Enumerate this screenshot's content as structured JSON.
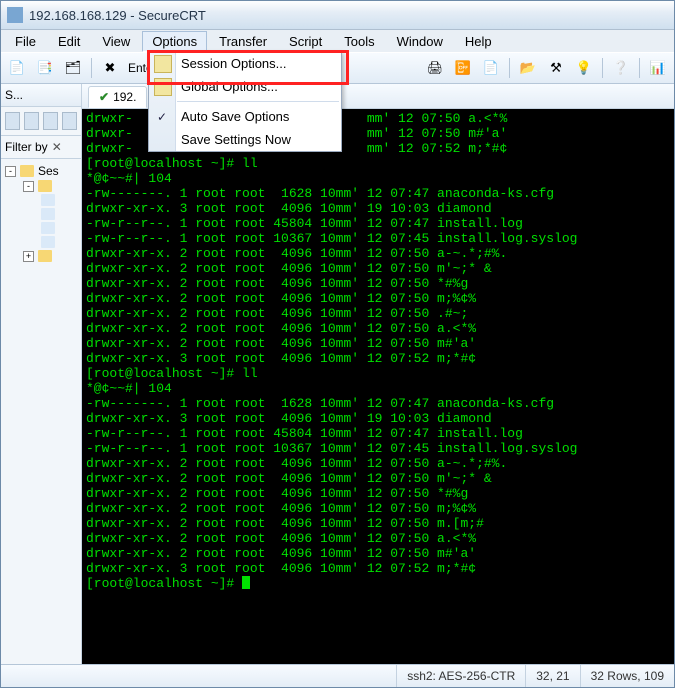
{
  "window": {
    "title": "192.168.168.129 - SecureCRT"
  },
  "menubar": [
    "File",
    "Edit",
    "View",
    "Options",
    "Transfer",
    "Script",
    "Tools",
    "Window",
    "Help"
  ],
  "menubar_open_index": 3,
  "toolbar": {
    "entry_label": "Ente"
  },
  "options_menu": {
    "session_options": "Session Options...",
    "global_options": "Global Options...",
    "auto_save": "Auto Save Options",
    "save_now": "Save Settings Now",
    "auto_save_checked": true
  },
  "sidebar": {
    "tab_label": "S...",
    "filter_label": "Filter by",
    "tree_root": "Ses"
  },
  "tab": {
    "label": "192."
  },
  "terminal_lines": [
    "drwxr-                              mm' 12 07:50 a.<*%",
    "drwxr-                              mm' 12 07:50 m#'a'",
    "drwxr-                              mm' 12 07:52 m;*#¢",
    "[root@localhost ~]# ll",
    "*@¢~~#| 104",
    "-rw-------. 1 root root  1628 10mm' 12 07:47 anaconda-ks.cfg",
    "drwxr-xr-x. 3 root root  4096 10mm' 19 10:03 diamond",
    "-rw-r--r--. 1 root root 45804 10mm' 12 07:47 install.log",
    "-rw-r--r--. 1 root root 10367 10mm' 12 07:45 install.log.syslog",
    "drwxr-xr-x. 2 root root  4096 10mm' 12 07:50 a-~.*;#%.",
    "drwxr-xr-x. 2 root root  4096 10mm' 12 07:50 m'~;* &",
    "drwxr-xr-x. 2 root root  4096 10mm' 12 07:50 *#%g  ",
    "drwxr-xr-x. 2 root root  4096 10mm' 12 07:50 m;%¢%",
    "drwxr-xr-x. 2 root root  4096 10mm' 12 07:50 .#~;  ",
    "drwxr-xr-x. 2 root root  4096 10mm' 12 07:50 a.<*% ",
    "drwxr-xr-x. 2 root root  4096 10mm' 12 07:50 m#'a' ",
    "drwxr-xr-x. 3 root root  4096 10mm' 12 07:52 m;*#¢ ",
    "[root@localhost ~]# ll",
    "*@¢~~#| 104",
    "-rw-------. 1 root root  1628 10mm' 12 07:47 anaconda-ks.cfg",
    "drwxr-xr-x. 3 root root  4096 10mm' 19 10:03 diamond",
    "-rw-r--r--. 1 root root 45804 10mm' 12 07:47 install.log",
    "-rw-r--r--. 1 root root 10367 10mm' 12 07:45 install.log.syslog",
    "drwxr-xr-x. 2 root root  4096 10mm' 12 07:50 a-~.*;#%.",
    "drwxr-xr-x. 2 root root  4096 10mm' 12 07:50 m'~;* &",
    "drwxr-xr-x. 2 root root  4096 10mm' 12 07:50 *#%g  ",
    "drwxr-xr-x. 2 root root  4096 10mm' 12 07:50 m;%¢%",
    "drwxr-xr-x. 2 root root  4096 10mm' 12 07:50 m.[m;#",
    "drwxr-xr-x. 2 root root  4096 10mm' 12 07:50 a.<*% ",
    "drwxr-xr-x. 2 root root  4096 10mm' 12 07:50 m#'a' ",
    "drwxr-xr-x. 3 root root  4096 10mm' 12 07:52 m;*#¢ ",
    "[root@localhost ~]# "
  ],
  "statusbar": {
    "proto": "ssh2: AES-256-CTR",
    "cursor": "32, 21",
    "size": "32 Rows, 109"
  }
}
